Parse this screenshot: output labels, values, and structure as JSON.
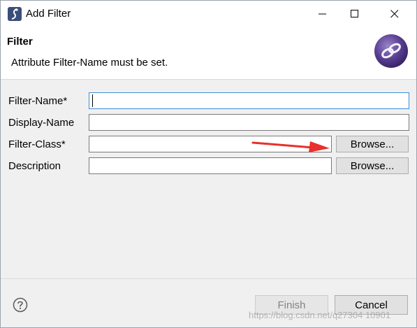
{
  "window": {
    "title": "Add Filter",
    "controls": {
      "minimize": "minimize",
      "maximize": "maximize",
      "close": "close"
    }
  },
  "header": {
    "title": "Filter",
    "message": "Attribute Filter-Name must be set.",
    "icon": "eclipse-wizard-icon"
  },
  "form": {
    "filter_name": {
      "label": "Filter-Name*",
      "value": ""
    },
    "display_name": {
      "label": "Display-Name",
      "value": ""
    },
    "filter_class": {
      "label": "Filter-Class*",
      "value": "",
      "browse_label": "Browse..."
    },
    "description": {
      "label": "Description",
      "value": "",
      "browse_label": "Browse..."
    }
  },
  "footer": {
    "help_icon": "help-icon",
    "finish_label": "Finish",
    "cancel_label": "Cancel"
  },
  "annotation": {
    "arrow_color": "#e8312a"
  },
  "watermark": "https://blog.csdn.net/q27304 10901"
}
